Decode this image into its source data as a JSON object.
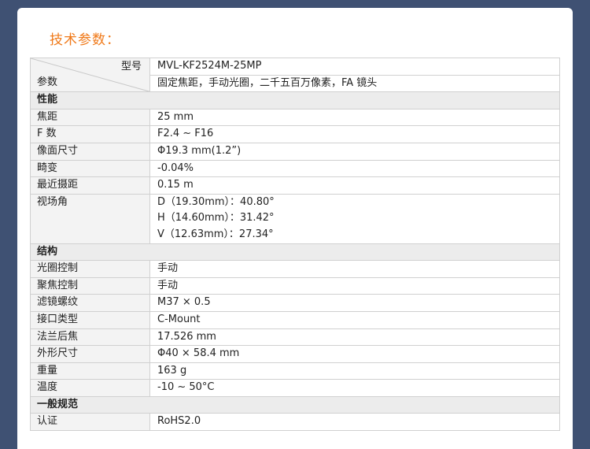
{
  "title": "技术参数：",
  "header": {
    "model_label": "型号",
    "param_label": "参数",
    "model_value": "MVL-KF2524M-25MP",
    "desc_value": "固定焦距，手动光圈，二千五百万像素，FA 镜头"
  },
  "sections": {
    "performance": {
      "title": "性能",
      "rows": [
        {
          "label": "焦距",
          "value": "25 mm"
        },
        {
          "label": "F 数",
          "value": "F2.4 ~ F16"
        },
        {
          "label": "像面尺寸",
          "value": "Φ19.3 mm(1.2”)"
        },
        {
          "label": "畸变",
          "value": "-0.04%"
        },
        {
          "label": "最近摄距",
          "value": "0.15 m"
        }
      ],
      "fov": {
        "label": "视场角",
        "lines": [
          "D（19.30mm）：40.80°",
          "H（14.60mm）：31.42°",
          "V（12.63mm）：27.34°"
        ]
      }
    },
    "structure": {
      "title": "结构",
      "rows": [
        {
          "label": "光圈控制",
          "value": "手动"
        },
        {
          "label": "聚焦控制",
          "value": "手动"
        },
        {
          "label": "滤镜螺纹",
          "value": "M37 × 0.5"
        },
        {
          "label": "接口类型",
          "value": "C-Mount"
        },
        {
          "label": "法兰后焦",
          "value": "17.526 mm"
        },
        {
          "label": "外形尺寸",
          "value": "Φ40 × 58.4 mm"
        },
        {
          "label": "重量",
          "value": "163 g"
        },
        {
          "label": "温度",
          "value": "-10 ~ 50°C"
        }
      ]
    },
    "general": {
      "title": "一般规范",
      "rows": [
        {
          "label": "认证",
          "value": "RoHS2.0"
        }
      ]
    }
  },
  "colors": {
    "background": "#3f5173",
    "title": "#f07a1a",
    "label_cell": "#f3f3f3",
    "border": "#d0d0d0"
  }
}
